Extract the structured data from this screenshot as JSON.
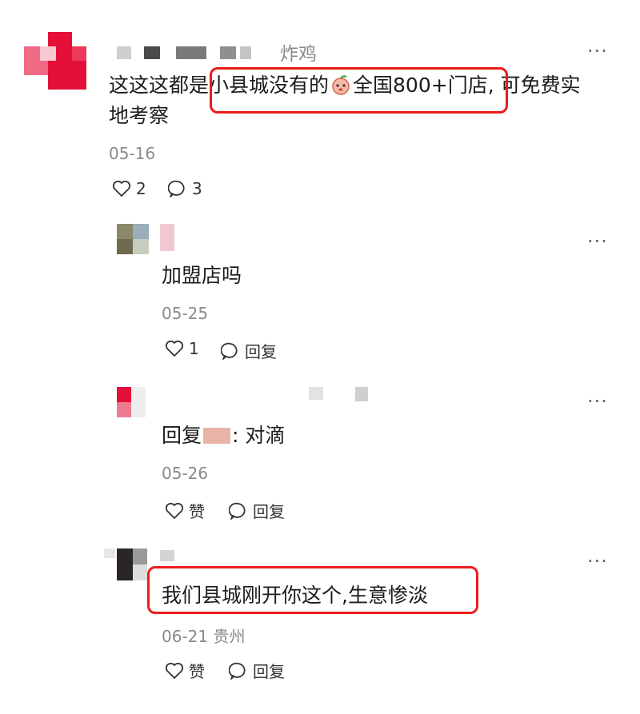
{
  "comments": [
    {
      "nickname_visible": "炸鸡",
      "text_pre": "这这这都是",
      "text_highlight_a": "小县城没有的",
      "text_highlight_b": "全国800+门店,",
      "text_post_line1": " 可免费实",
      "text_post_line2": "地考察",
      "date": "05-16",
      "likes": "2",
      "replies": "3",
      "emoji": "peach-emoji"
    },
    {
      "text": "加盟店吗",
      "date": "05-25",
      "likes": "1",
      "reply_label": "回复"
    },
    {
      "text_prefix": "回复",
      "text_suffix": ": 对滴",
      "date": "05-26",
      "like_label": "赞",
      "reply_label": "回复"
    },
    {
      "text": "我们县城刚开你这个,生意惨淡",
      "date": "06-21",
      "location": "贵州",
      "like_label": "赞",
      "reply_label": "回复"
    }
  ],
  "more_glyph": "···",
  "colors": {
    "highlight": "#ee1c1c",
    "avatar_red": "#e5103a",
    "muted": "#8a8a8a"
  },
  "icons": [
    "heart-icon",
    "comment-bubble-icon",
    "more-icon"
  ]
}
